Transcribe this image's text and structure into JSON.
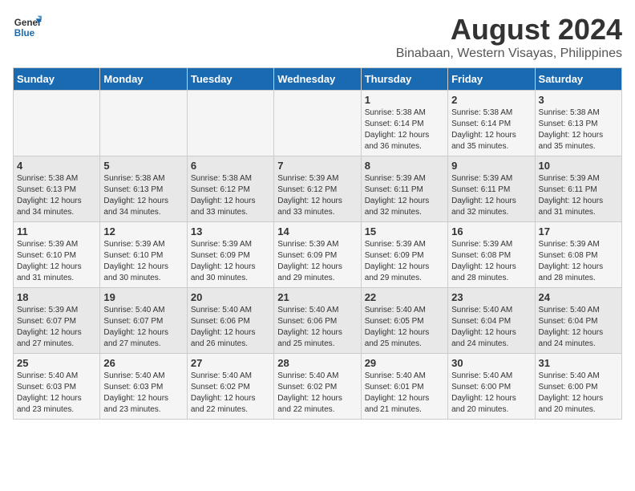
{
  "logo": {
    "line1": "General",
    "line2": "Blue"
  },
  "title": "August 2024",
  "subtitle": "Binabaan, Western Visayas, Philippines",
  "days_of_week": [
    "Sunday",
    "Monday",
    "Tuesday",
    "Wednesday",
    "Thursday",
    "Friday",
    "Saturday"
  ],
  "weeks": [
    [
      {
        "num": "",
        "info": ""
      },
      {
        "num": "",
        "info": ""
      },
      {
        "num": "",
        "info": ""
      },
      {
        "num": "",
        "info": ""
      },
      {
        "num": "1",
        "info": "Sunrise: 5:38 AM\nSunset: 6:14 PM\nDaylight: 12 hours\nand 36 minutes."
      },
      {
        "num": "2",
        "info": "Sunrise: 5:38 AM\nSunset: 6:14 PM\nDaylight: 12 hours\nand 35 minutes."
      },
      {
        "num": "3",
        "info": "Sunrise: 5:38 AM\nSunset: 6:13 PM\nDaylight: 12 hours\nand 35 minutes."
      }
    ],
    [
      {
        "num": "4",
        "info": "Sunrise: 5:38 AM\nSunset: 6:13 PM\nDaylight: 12 hours\nand 34 minutes."
      },
      {
        "num": "5",
        "info": "Sunrise: 5:38 AM\nSunset: 6:13 PM\nDaylight: 12 hours\nand 34 minutes."
      },
      {
        "num": "6",
        "info": "Sunrise: 5:38 AM\nSunset: 6:12 PM\nDaylight: 12 hours\nand 33 minutes."
      },
      {
        "num": "7",
        "info": "Sunrise: 5:39 AM\nSunset: 6:12 PM\nDaylight: 12 hours\nand 33 minutes."
      },
      {
        "num": "8",
        "info": "Sunrise: 5:39 AM\nSunset: 6:11 PM\nDaylight: 12 hours\nand 32 minutes."
      },
      {
        "num": "9",
        "info": "Sunrise: 5:39 AM\nSunset: 6:11 PM\nDaylight: 12 hours\nand 32 minutes."
      },
      {
        "num": "10",
        "info": "Sunrise: 5:39 AM\nSunset: 6:11 PM\nDaylight: 12 hours\nand 31 minutes."
      }
    ],
    [
      {
        "num": "11",
        "info": "Sunrise: 5:39 AM\nSunset: 6:10 PM\nDaylight: 12 hours\nand 31 minutes."
      },
      {
        "num": "12",
        "info": "Sunrise: 5:39 AM\nSunset: 6:10 PM\nDaylight: 12 hours\nand 30 minutes."
      },
      {
        "num": "13",
        "info": "Sunrise: 5:39 AM\nSunset: 6:09 PM\nDaylight: 12 hours\nand 30 minutes."
      },
      {
        "num": "14",
        "info": "Sunrise: 5:39 AM\nSunset: 6:09 PM\nDaylight: 12 hours\nand 29 minutes."
      },
      {
        "num": "15",
        "info": "Sunrise: 5:39 AM\nSunset: 6:09 PM\nDaylight: 12 hours\nand 29 minutes."
      },
      {
        "num": "16",
        "info": "Sunrise: 5:39 AM\nSunset: 6:08 PM\nDaylight: 12 hours\nand 28 minutes."
      },
      {
        "num": "17",
        "info": "Sunrise: 5:39 AM\nSunset: 6:08 PM\nDaylight: 12 hours\nand 28 minutes."
      }
    ],
    [
      {
        "num": "18",
        "info": "Sunrise: 5:39 AM\nSunset: 6:07 PM\nDaylight: 12 hours\nand 27 minutes."
      },
      {
        "num": "19",
        "info": "Sunrise: 5:40 AM\nSunset: 6:07 PM\nDaylight: 12 hours\nand 27 minutes."
      },
      {
        "num": "20",
        "info": "Sunrise: 5:40 AM\nSunset: 6:06 PM\nDaylight: 12 hours\nand 26 minutes."
      },
      {
        "num": "21",
        "info": "Sunrise: 5:40 AM\nSunset: 6:06 PM\nDaylight: 12 hours\nand 25 minutes."
      },
      {
        "num": "22",
        "info": "Sunrise: 5:40 AM\nSunset: 6:05 PM\nDaylight: 12 hours\nand 25 minutes."
      },
      {
        "num": "23",
        "info": "Sunrise: 5:40 AM\nSunset: 6:04 PM\nDaylight: 12 hours\nand 24 minutes."
      },
      {
        "num": "24",
        "info": "Sunrise: 5:40 AM\nSunset: 6:04 PM\nDaylight: 12 hours\nand 24 minutes."
      }
    ],
    [
      {
        "num": "25",
        "info": "Sunrise: 5:40 AM\nSunset: 6:03 PM\nDaylight: 12 hours\nand 23 minutes."
      },
      {
        "num": "26",
        "info": "Sunrise: 5:40 AM\nSunset: 6:03 PM\nDaylight: 12 hours\nand 23 minutes."
      },
      {
        "num": "27",
        "info": "Sunrise: 5:40 AM\nSunset: 6:02 PM\nDaylight: 12 hours\nand 22 minutes."
      },
      {
        "num": "28",
        "info": "Sunrise: 5:40 AM\nSunset: 6:02 PM\nDaylight: 12 hours\nand 22 minutes."
      },
      {
        "num": "29",
        "info": "Sunrise: 5:40 AM\nSunset: 6:01 PM\nDaylight: 12 hours\nand 21 minutes."
      },
      {
        "num": "30",
        "info": "Sunrise: 5:40 AM\nSunset: 6:00 PM\nDaylight: 12 hours\nand 20 minutes."
      },
      {
        "num": "31",
        "info": "Sunrise: 5:40 AM\nSunset: 6:00 PM\nDaylight: 12 hours\nand 20 minutes."
      }
    ]
  ]
}
